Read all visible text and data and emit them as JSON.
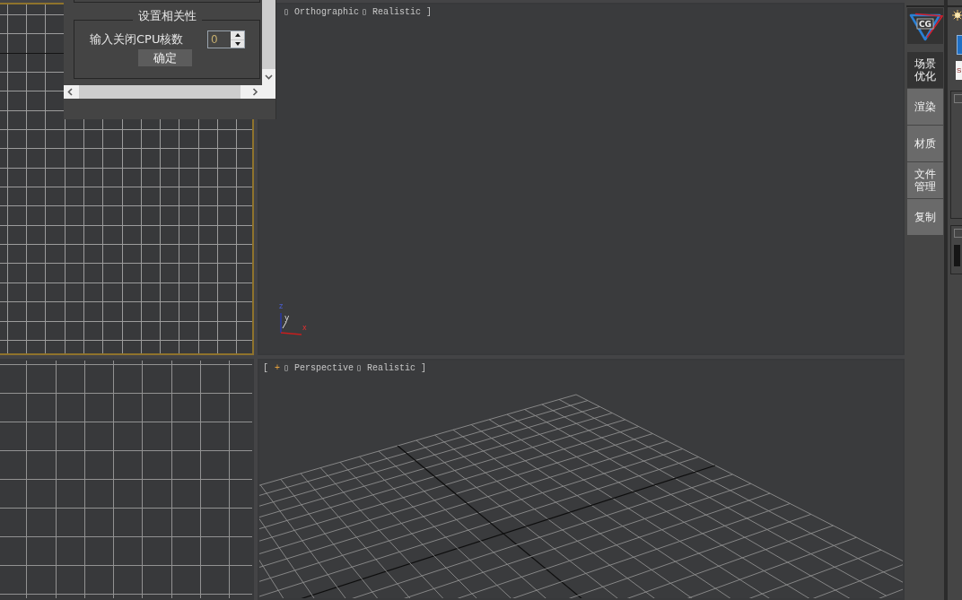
{
  "viewports": [
    {
      "kind": "top-grid",
      "active": true
    },
    {
      "kind": "ortho",
      "active": false,
      "label": [
        {
          "kind": "view",
          "text": "▯ Orthographic"
        },
        {
          "kind": "shading",
          "text": "▯ Realistic"
        },
        {
          "kind": "close",
          "text": "]"
        }
      ],
      "gizmo": [
        {
          "kind": "z",
          "text": "z"
        },
        {
          "kind": "y",
          "text": "y"
        },
        {
          "kind": "x",
          "text": "x"
        }
      ]
    },
    {
      "kind": "side-grid",
      "active": false
    },
    {
      "kind": "perspective",
      "active": false,
      "label": [
        {
          "kind": "open",
          "text": "["
        },
        {
          "kind": "menu",
          "text": "+"
        },
        {
          "kind": "view",
          "text": "▯ Perspective"
        },
        {
          "kind": "shading",
          "text": "▯ Realistic"
        },
        {
          "kind": "close",
          "text": "]"
        }
      ]
    }
  ],
  "floating_panel": {
    "group_title": "设置相关性",
    "cpu_label": "输入关闭CPU核数",
    "cpu_spinner": {
      "value": "0",
      "disabled": true
    },
    "confirm_button": "确定"
  },
  "side_panel": {
    "logo_text": "CG",
    "tabs": [
      {
        "label": "场景优化",
        "selected": true
      },
      {
        "label": "渲染",
        "selected": false
      },
      {
        "label": "材质",
        "selected": false
      },
      {
        "label": "文件管理",
        "selected": false
      },
      {
        "label": "复制",
        "selected": false
      }
    ]
  },
  "command_panel": {
    "name_field": "S"
  }
}
